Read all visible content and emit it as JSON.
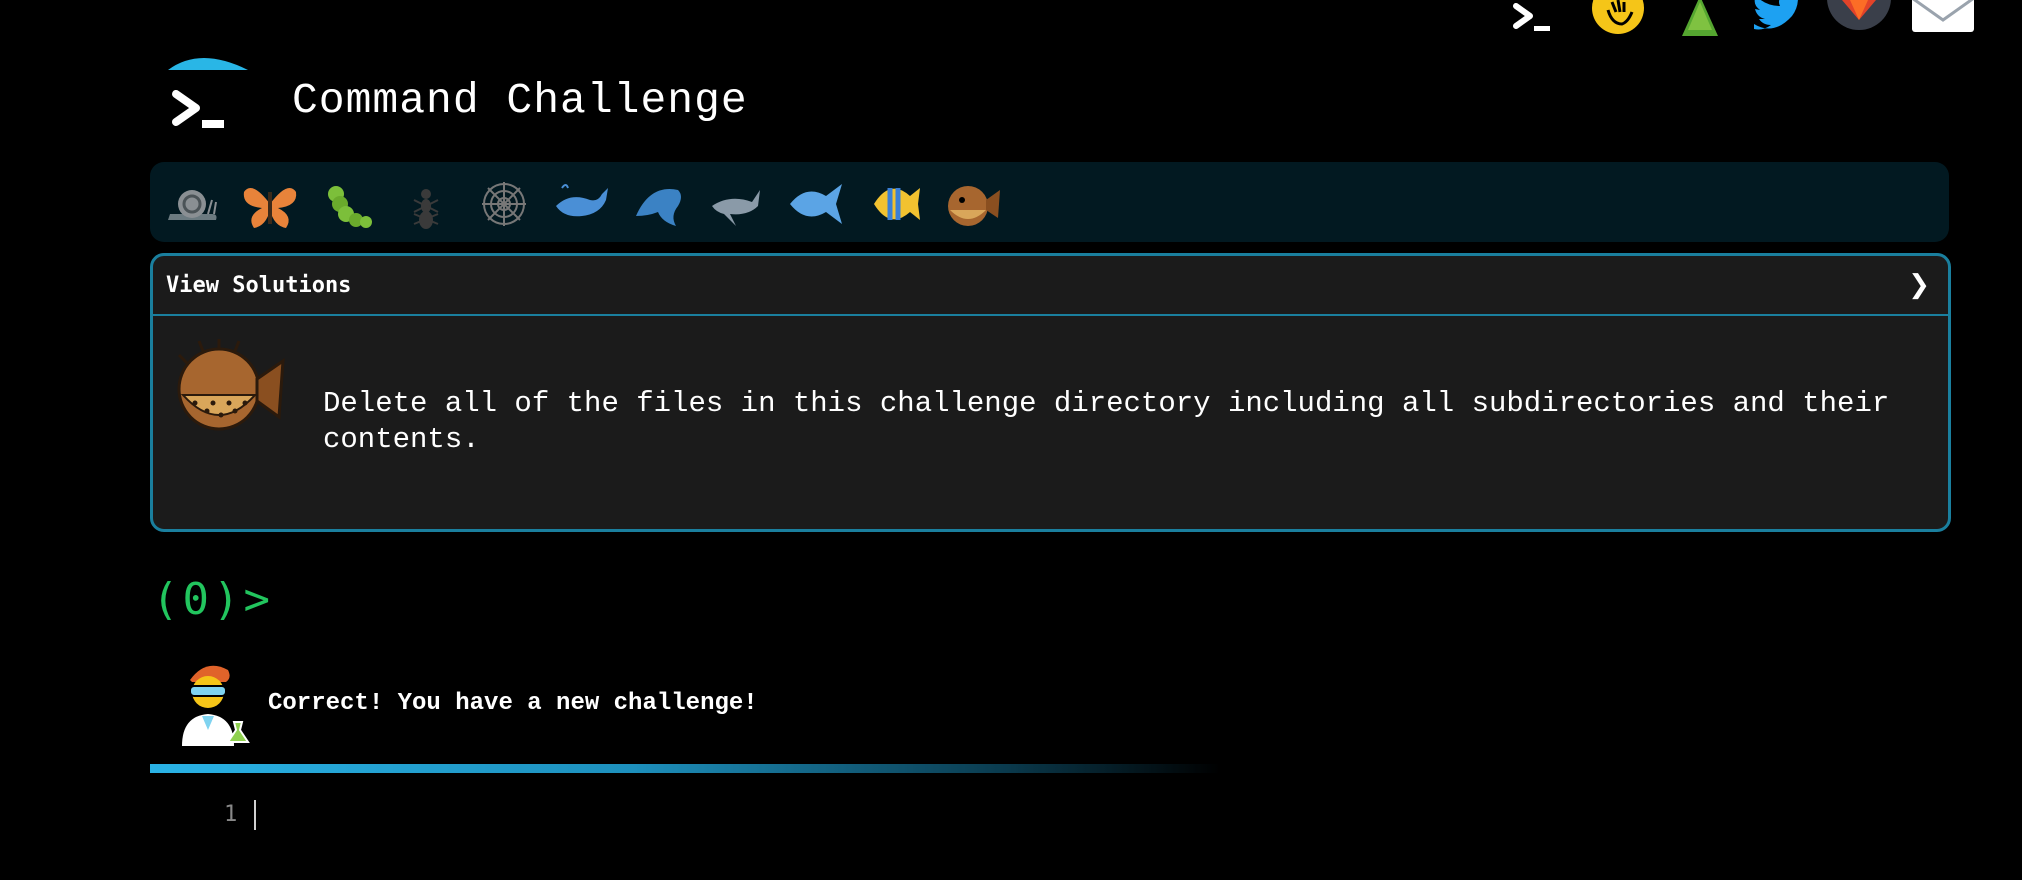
{
  "header": {
    "title": "Command Challenge"
  },
  "top_icons": [
    "terminal-icon",
    "hand-coin-icon",
    "tree-icon",
    "twitter-icon",
    "gitlab-icon",
    "mail-icon"
  ],
  "levels": [
    {
      "name": "snail-icon"
    },
    {
      "name": "butterfly-icon"
    },
    {
      "name": "caterpillar-icon"
    },
    {
      "name": "ant-icon"
    },
    {
      "name": "spider-web-icon"
    },
    {
      "name": "whale-icon"
    },
    {
      "name": "dolphin-icon"
    },
    {
      "name": "shark-icon"
    },
    {
      "name": "fish-icon"
    },
    {
      "name": "tropical-fish-icon"
    },
    {
      "name": "blowfish-icon"
    }
  ],
  "challenge": {
    "toggle_label": "View Solutions",
    "chevron": "❯",
    "description": "Delete all of the files in this challenge directory including all subdirectories and their contents."
  },
  "prompt": {
    "text": "(0)>"
  },
  "feedback": {
    "message": "Correct! You have a new challenge!"
  },
  "editor": {
    "line_number": "1"
  },
  "colors": {
    "background": "#000000",
    "accent": "#1a7f9e",
    "prompt_green": "#22c55e",
    "level_bar": "#021921",
    "panel": "#1b1b1b"
  }
}
